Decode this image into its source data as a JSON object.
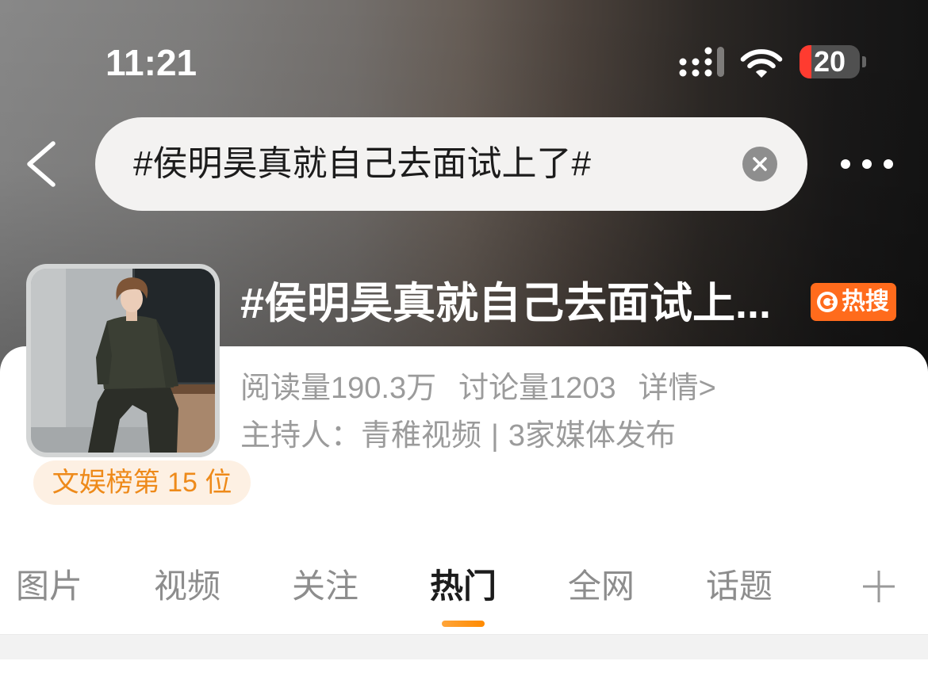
{
  "status_bar": {
    "time": "11:21",
    "battery_level": "20"
  },
  "nav": {
    "search_text": "#侯明昊真就自己去面试上了#"
  },
  "topic": {
    "title": "#侯明昊真就自己去面试上...",
    "hot_badge": "热搜",
    "stats": {
      "reads": "阅读量190.3万",
      "discussions": "讨论量1203",
      "details_link": "详情>"
    },
    "host": {
      "label": "主持人：",
      "name": "青稚视频",
      "separator": "|",
      "media": "3家媒体发布"
    },
    "rank": "文娱榜第 15 位"
  },
  "tabs": [
    {
      "label": "图片",
      "active": false
    },
    {
      "label": "视频",
      "active": false
    },
    {
      "label": "关注",
      "active": false
    },
    {
      "label": "热门",
      "active": true
    },
    {
      "label": "全网",
      "active": false
    },
    {
      "label": "话题",
      "active": false
    }
  ],
  "icons": {
    "signal": "signal-icon",
    "wifi": "wifi-icon",
    "battery": "battery-icon",
    "back": "chevron-left-icon",
    "clear": "clear-circle-icon",
    "more": "more-dots-icon",
    "hot_badge": "hot-search-icon",
    "add_tab": "plus-icon"
  },
  "colors": {
    "accent": "#ff8a00",
    "hot_badge_bg": "#ff6b1c",
    "rank_text": "#ee8a1a",
    "rank_bg": "#fdf0e3",
    "muted_text": "#9b9b9b",
    "active_tab_text": "#1c1c1c",
    "battery_low": "#ff3b30"
  }
}
